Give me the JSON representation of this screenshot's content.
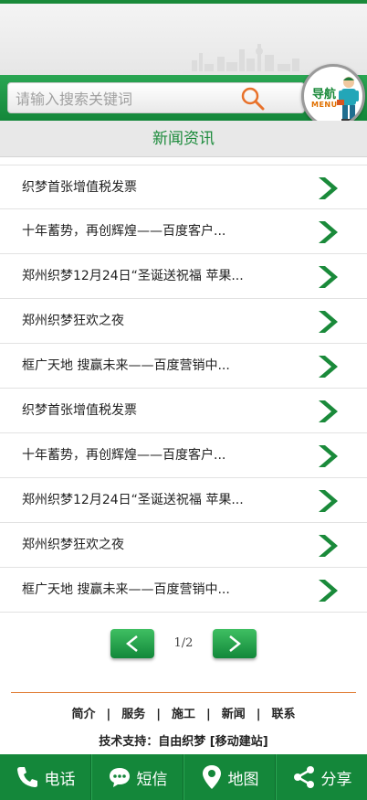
{
  "search": {
    "placeholder": "请输入搜索关键词"
  },
  "nav_badge": {
    "label_cn": "导航",
    "label_en": "MENU"
  },
  "section": {
    "title": "新闻资讯"
  },
  "news": [
    {
      "title": "织梦首张增值税发票"
    },
    {
      "title": "十年蓄势，再创辉煌——百度客户..."
    },
    {
      "title": "郑州织梦12月24日“圣诞送祝福 苹果..."
    },
    {
      "title": "郑州织梦狂欢之夜"
    },
    {
      "title": "框广天地 搜赢未来——百度营销中..."
    },
    {
      "title": "织梦首张增值税发票"
    },
    {
      "title": "十年蓄势，再创辉煌——百度客户..."
    },
    {
      "title": "郑州织梦12月24日“圣诞送祝福 苹果..."
    },
    {
      "title": "郑州织梦狂欢之夜"
    },
    {
      "title": "框广天地 搜赢未来——百度营销中..."
    }
  ],
  "pager": {
    "current": "1/2"
  },
  "footer": {
    "links": [
      "简介",
      "服务",
      "施工",
      "新闻",
      "联系"
    ],
    "support_prefix": "技术支持：自由织梦 [",
    "support_link": "移动建站",
    "support_suffix": "]"
  },
  "bottom_bar": [
    {
      "label": "电话",
      "icon": "phone-icon"
    },
    {
      "label": "短信",
      "icon": "sms-icon"
    },
    {
      "label": "地图",
      "icon": "map-pin-icon"
    },
    {
      "label": "分享",
      "icon": "share-icon"
    }
  ],
  "colors": {
    "brand_green": "#1a8a3a",
    "accent_orange": "#e07a30"
  }
}
